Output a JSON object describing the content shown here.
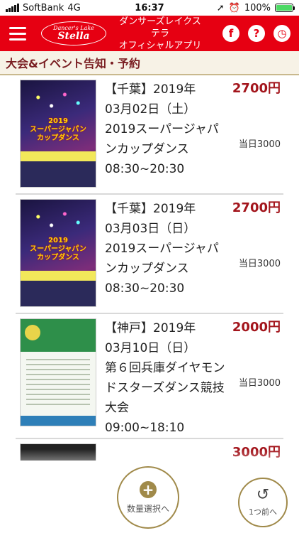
{
  "status": {
    "carrier": "SoftBank",
    "network": "4G",
    "time": "16:37",
    "battery": "100%"
  },
  "header": {
    "logo_small": "Dancer's Lake",
    "logo_big": "Stella",
    "title_line1": "ダンサーズレイクステラ",
    "title_line2": "オフィシャルアプリ",
    "icons": [
      "facebook-icon",
      "help-icon",
      "clock-icon"
    ],
    "facebook_glyph": "f",
    "help_glyph": "?",
    "clock_glyph": "◷"
  },
  "section": {
    "title": "大会&イベント告知・予約"
  },
  "events": [
    {
      "line1": "【千葉】2019年",
      "line2": "03月02日（土）",
      "line3": "2019スーパージャパ",
      "line4": "ンカップダンス",
      "line5": "08:30~20:30",
      "price": "2700円",
      "door_price": "当日3000",
      "poster_title_1": "2019",
      "poster_title_2": "スーパージャパン",
      "poster_title_3": "カップダンス"
    },
    {
      "line1": "【千葉】2019年",
      "line2": "03月03日（日）",
      "line3": "2019スーパージャパ",
      "line4": "ンカップダンス",
      "line5": "08:30~20:30",
      "price": "2700円",
      "door_price": "当日3000",
      "poster_title_1": "2019",
      "poster_title_2": "スーパージャパン",
      "poster_title_3": "カップダンス"
    },
    {
      "line1": "【神戸】2019年",
      "line2": "03月10日（日）",
      "line3": "第６回兵庫ダイヤモン",
      "line4": "ドスターズダンス競技",
      "line5": "大会",
      "line6": "09:00~18:10",
      "price": "2000円",
      "door_price": "当日3000"
    }
  ],
  "partial_event": {
    "price": "3000円"
  },
  "buttons": {
    "quantity_label": "数量選択へ",
    "back_label": "1つ前へ",
    "plus_glyph": "+",
    "back_glyph": "↺"
  },
  "colors": {
    "header_red": "#e60012",
    "price_red": "#a3151c",
    "section_text": "#7a1e22",
    "gold": "#a08a4a"
  }
}
